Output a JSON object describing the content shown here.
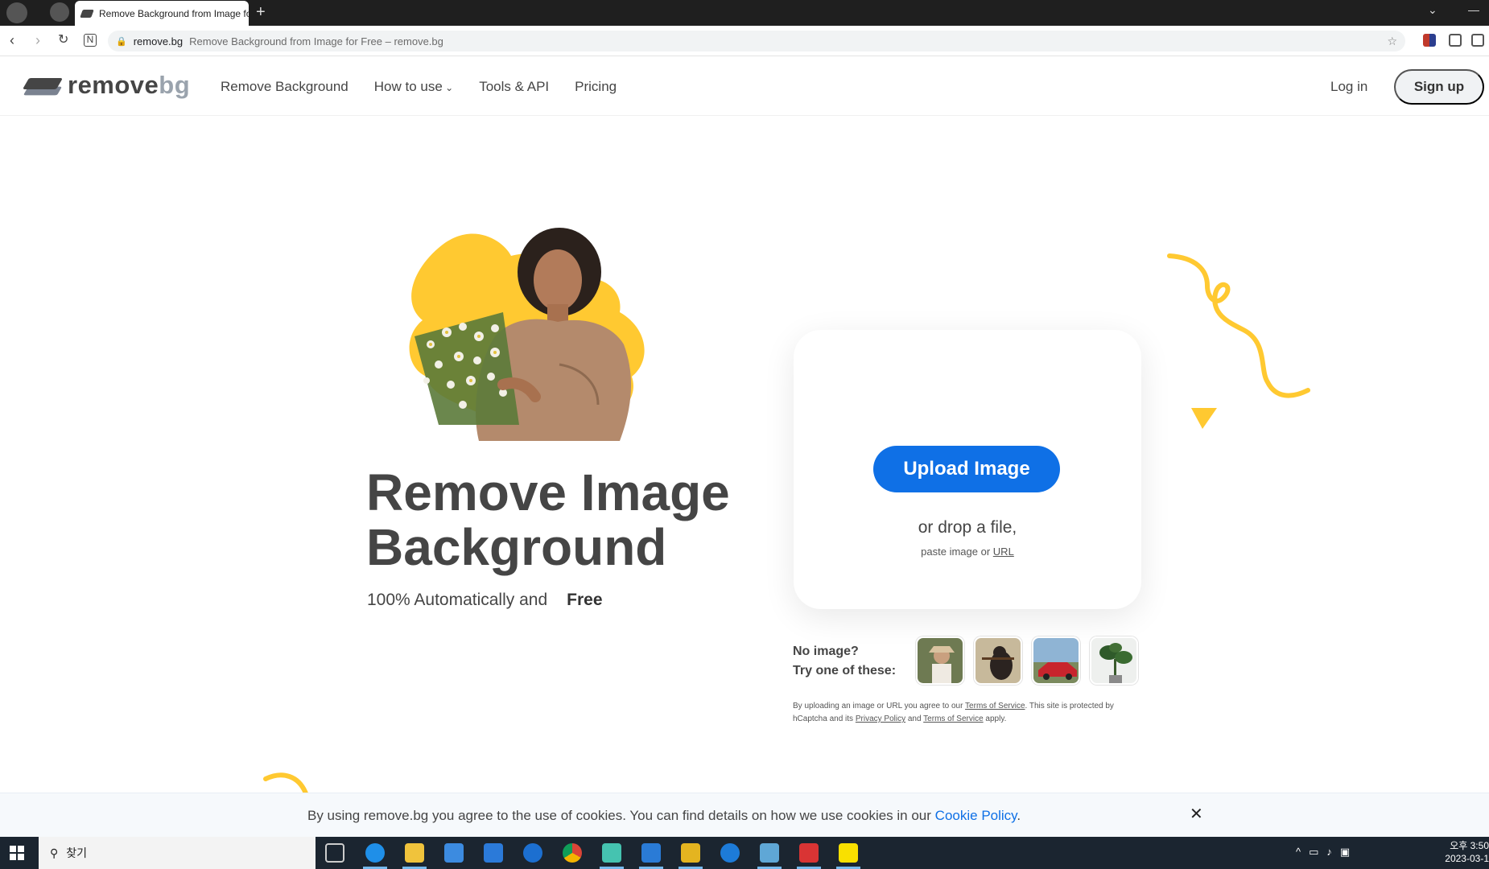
{
  "browser": {
    "tab_title": "Remove Background from Image for Free – remove.bg",
    "url_domain": "remove.bg",
    "url_page_title": "Remove Background from Image for Free – remove.bg"
  },
  "header": {
    "logo_main": "remove",
    "logo_suffix": "bg",
    "nav": [
      "Remove Background",
      "How to use",
      "Tools & API",
      "Pricing"
    ],
    "login": "Log in",
    "signup": "Sign up"
  },
  "hero": {
    "title_line1": "Remove Image",
    "title_line2": "Background",
    "subtitle": "100% Automatically and",
    "free_badge": "Free"
  },
  "upload": {
    "button": "Upload Image",
    "drop_text": "or drop a file,",
    "paste_prefix": "paste image or",
    "paste_link": "URL"
  },
  "samples": {
    "label_line1": "No image?",
    "label_line2": "Try one of these:"
  },
  "legal": {
    "t1": "By uploading an image or URL you agree to our",
    "tos": "Terms of Service",
    "t2": ". This site is protected by hCaptcha and its",
    "privacy": "Privacy Policy",
    "t3": "and",
    "tos2": "Terms of Service",
    "t4": "apply."
  },
  "cookie": {
    "text": "By using remove.bg you agree to the use of cookies. You can find details on how we use cookies in our",
    "link": "Cookie Policy",
    "end": ".",
    "close": "✕"
  },
  "taskbar": {
    "search_label": "찾기",
    "time": "오후 3:50",
    "date": "2023-03-1"
  },
  "colors": {
    "accent_blue": "#0f70e6",
    "brand_yellow": "#ffc931",
    "text_dark": "#454545"
  }
}
